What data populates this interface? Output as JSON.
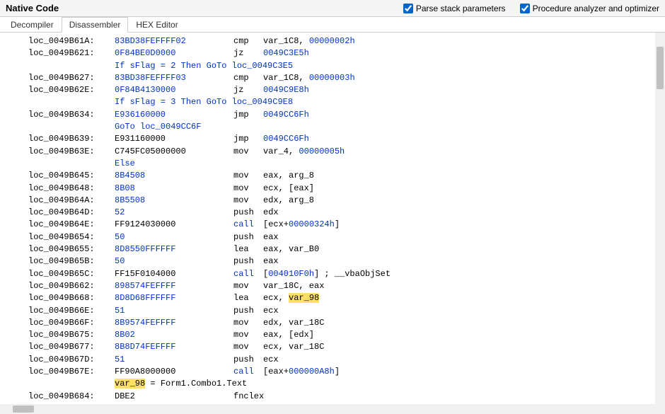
{
  "header": {
    "title": "Native Code",
    "cb1_label": "Parse stack parameters",
    "cb2_label": "Procedure analyzer and optimizer"
  },
  "tabs": {
    "t0": "Decompiler",
    "t1": "Disassembler",
    "t2": "HEX Editor",
    "active": "t1"
  },
  "code": [
    {
      "addr": "loc_0049B61A:",
      "hex": "83BD38FEFFFF02",
      "m": "cmp",
      "ops": [
        {
          "t": "var_1C8",
          "c": "black"
        },
        {
          "t": ", "
        },
        {
          "t": "00000002h",
          "c": "blue"
        }
      ],
      "hexBlue": true
    },
    {
      "addr": "loc_0049B621:",
      "hex": "0F84BE0D0000",
      "m": "jz",
      "ops": [
        {
          "t": "0049C3E5h",
          "c": "blue"
        }
      ],
      "hexBlue": true
    },
    {
      "comment": "If sFlag = 2 Then GoTo loc_0049C3E5",
      "c": "blue"
    },
    {
      "addr": "loc_0049B627:",
      "hex": "83BD38FEFFFF03",
      "m": "cmp",
      "ops": [
        {
          "t": "var_1C8",
          "c": "black"
        },
        {
          "t": ", "
        },
        {
          "t": "00000003h",
          "c": "blue"
        }
      ],
      "hexBlue": true
    },
    {
      "addr": "loc_0049B62E:",
      "hex": "0F84B4130000",
      "m": "jz",
      "ops": [
        {
          "t": "0049C9E8h",
          "c": "blue"
        }
      ],
      "hexBlue": true
    },
    {
      "comment": "If sFlag = 3 Then GoTo loc_0049C9E8",
      "c": "blue"
    },
    {
      "addr": "loc_0049B634:",
      "hex": "E936160000",
      "m": "jmp",
      "ops": [
        {
          "t": "0049CC6Fh",
          "c": "blue"
        }
      ],
      "hexBlue": true
    },
    {
      "comment": "GoTo loc_0049CC6F",
      "c": "blue"
    },
    {
      "addr": "loc_0049B639:",
      "hex": "E931160000",
      "m": "jmp",
      "ops": [
        {
          "t": "0049CC6Fh",
          "c": "blue"
        }
      ]
    },
    {
      "addr": "loc_0049B63E:",
      "hex": "C745FC05000000",
      "m": "mov",
      "ops": [
        {
          "t": "var_4",
          "c": "black"
        },
        {
          "t": ", "
        },
        {
          "t": "00000005h",
          "c": "blue"
        }
      ]
    },
    {
      "comment": "Else",
      "c": "blue"
    },
    {
      "addr": "loc_0049B645:",
      "hex": "8B4508",
      "m": "mov",
      "ops": [
        {
          "t": "eax, arg_8",
          "c": "black"
        }
      ],
      "hexBlue": true
    },
    {
      "addr": "loc_0049B648:",
      "hex": "8B08",
      "m": "mov",
      "ops": [
        {
          "t": "ecx, [eax]",
          "c": "black"
        }
      ],
      "hexBlue": true
    },
    {
      "addr": "loc_0049B64A:",
      "hex": "8B5508",
      "m": "mov",
      "ops": [
        {
          "t": "edx, arg_8",
          "c": "black"
        }
      ],
      "hexBlue": true
    },
    {
      "addr": "loc_0049B64D:",
      "hex": "52",
      "m": "push",
      "ops": [
        {
          "t": "edx",
          "c": "black"
        }
      ],
      "hexBlue": true
    },
    {
      "addr": "loc_0049B64E:",
      "hex": "FF9124030000",
      "m": "call",
      "ops": [
        {
          "t": "[ecx+",
          "c": "black"
        },
        {
          "t": "00000324h",
          "c": "blue"
        },
        {
          "t": "]",
          "c": "black"
        }
      ],
      "mBlue": true
    },
    {
      "addr": "loc_0049B654:",
      "hex": "50",
      "m": "push",
      "ops": [
        {
          "t": "eax",
          "c": "black"
        }
      ],
      "hexBlue": true
    },
    {
      "addr": "loc_0049B655:",
      "hex": "8D8550FFFFFF",
      "m": "lea",
      "ops": [
        {
          "t": "eax, var_B0",
          "c": "black"
        }
      ],
      "hexBlue": true
    },
    {
      "addr": "loc_0049B65B:",
      "hex": "50",
      "m": "push",
      "ops": [
        {
          "t": "eax",
          "c": "black"
        }
      ],
      "hexBlue": true
    },
    {
      "addr": "loc_0049B65C:",
      "hex": "FF15F0104000",
      "m": "call",
      "ops": [
        {
          "t": "[",
          "c": "black"
        },
        {
          "t": "004010F0h",
          "c": "blue"
        },
        {
          "t": "] ; __vbaObjSet",
          "c": "black"
        }
      ],
      "mBlue": true
    },
    {
      "addr": "loc_0049B662:",
      "hex": "898574FEFFFF",
      "m": "mov",
      "ops": [
        {
          "t": "var_18C, eax",
          "c": "black"
        }
      ],
      "hexBlue": true
    },
    {
      "addr": "loc_0049B668:",
      "hex": "8D8D68FFFFFF",
      "m": "lea",
      "ops": [
        {
          "t": "ecx, ",
          "c": "black"
        },
        {
          "t": "var_98",
          "c": "black",
          "hl": true
        }
      ],
      "hexBlue": true
    },
    {
      "addr": "loc_0049B66E:",
      "hex": "51",
      "m": "push",
      "ops": [
        {
          "t": "ecx",
          "c": "black"
        }
      ],
      "hexBlue": true
    },
    {
      "addr": "loc_0049B66F:",
      "hex": "8B9574FEFFFF",
      "m": "mov",
      "ops": [
        {
          "t": "edx, var_18C",
          "c": "black"
        }
      ],
      "hexBlue": true
    },
    {
      "addr": "loc_0049B675:",
      "hex": "8B02",
      "m": "mov",
      "ops": [
        {
          "t": "eax, [edx]",
          "c": "black"
        }
      ],
      "hexBlue": true
    },
    {
      "addr": "loc_0049B677:",
      "hex": "8B8D74FEFFFF",
      "m": "mov",
      "ops": [
        {
          "t": "ecx, var_18C",
          "c": "black"
        }
      ],
      "hexBlue": true
    },
    {
      "addr": "loc_0049B67D:",
      "hex": "51",
      "m": "push",
      "ops": [
        {
          "t": "ecx",
          "c": "black"
        }
      ],
      "hexBlue": true
    },
    {
      "addr": "loc_0049B67E:",
      "hex": "FF90A8000000",
      "m": "call",
      "ops": [
        {
          "t": "[eax+",
          "c": "black"
        },
        {
          "t": "000000A8h",
          "c": "blue"
        },
        {
          "t": "]",
          "c": "black"
        }
      ],
      "mBlue": true
    },
    {
      "commentParts": [
        {
          "t": "var_98",
          "hl": true,
          "c": "black"
        },
        {
          "t": " = Form1.Combo1.Text",
          "c": "black"
        }
      ]
    },
    {
      "addr": "loc_0049B684:",
      "hex": "DBE2",
      "m": "fnclex",
      "ops": []
    }
  ]
}
